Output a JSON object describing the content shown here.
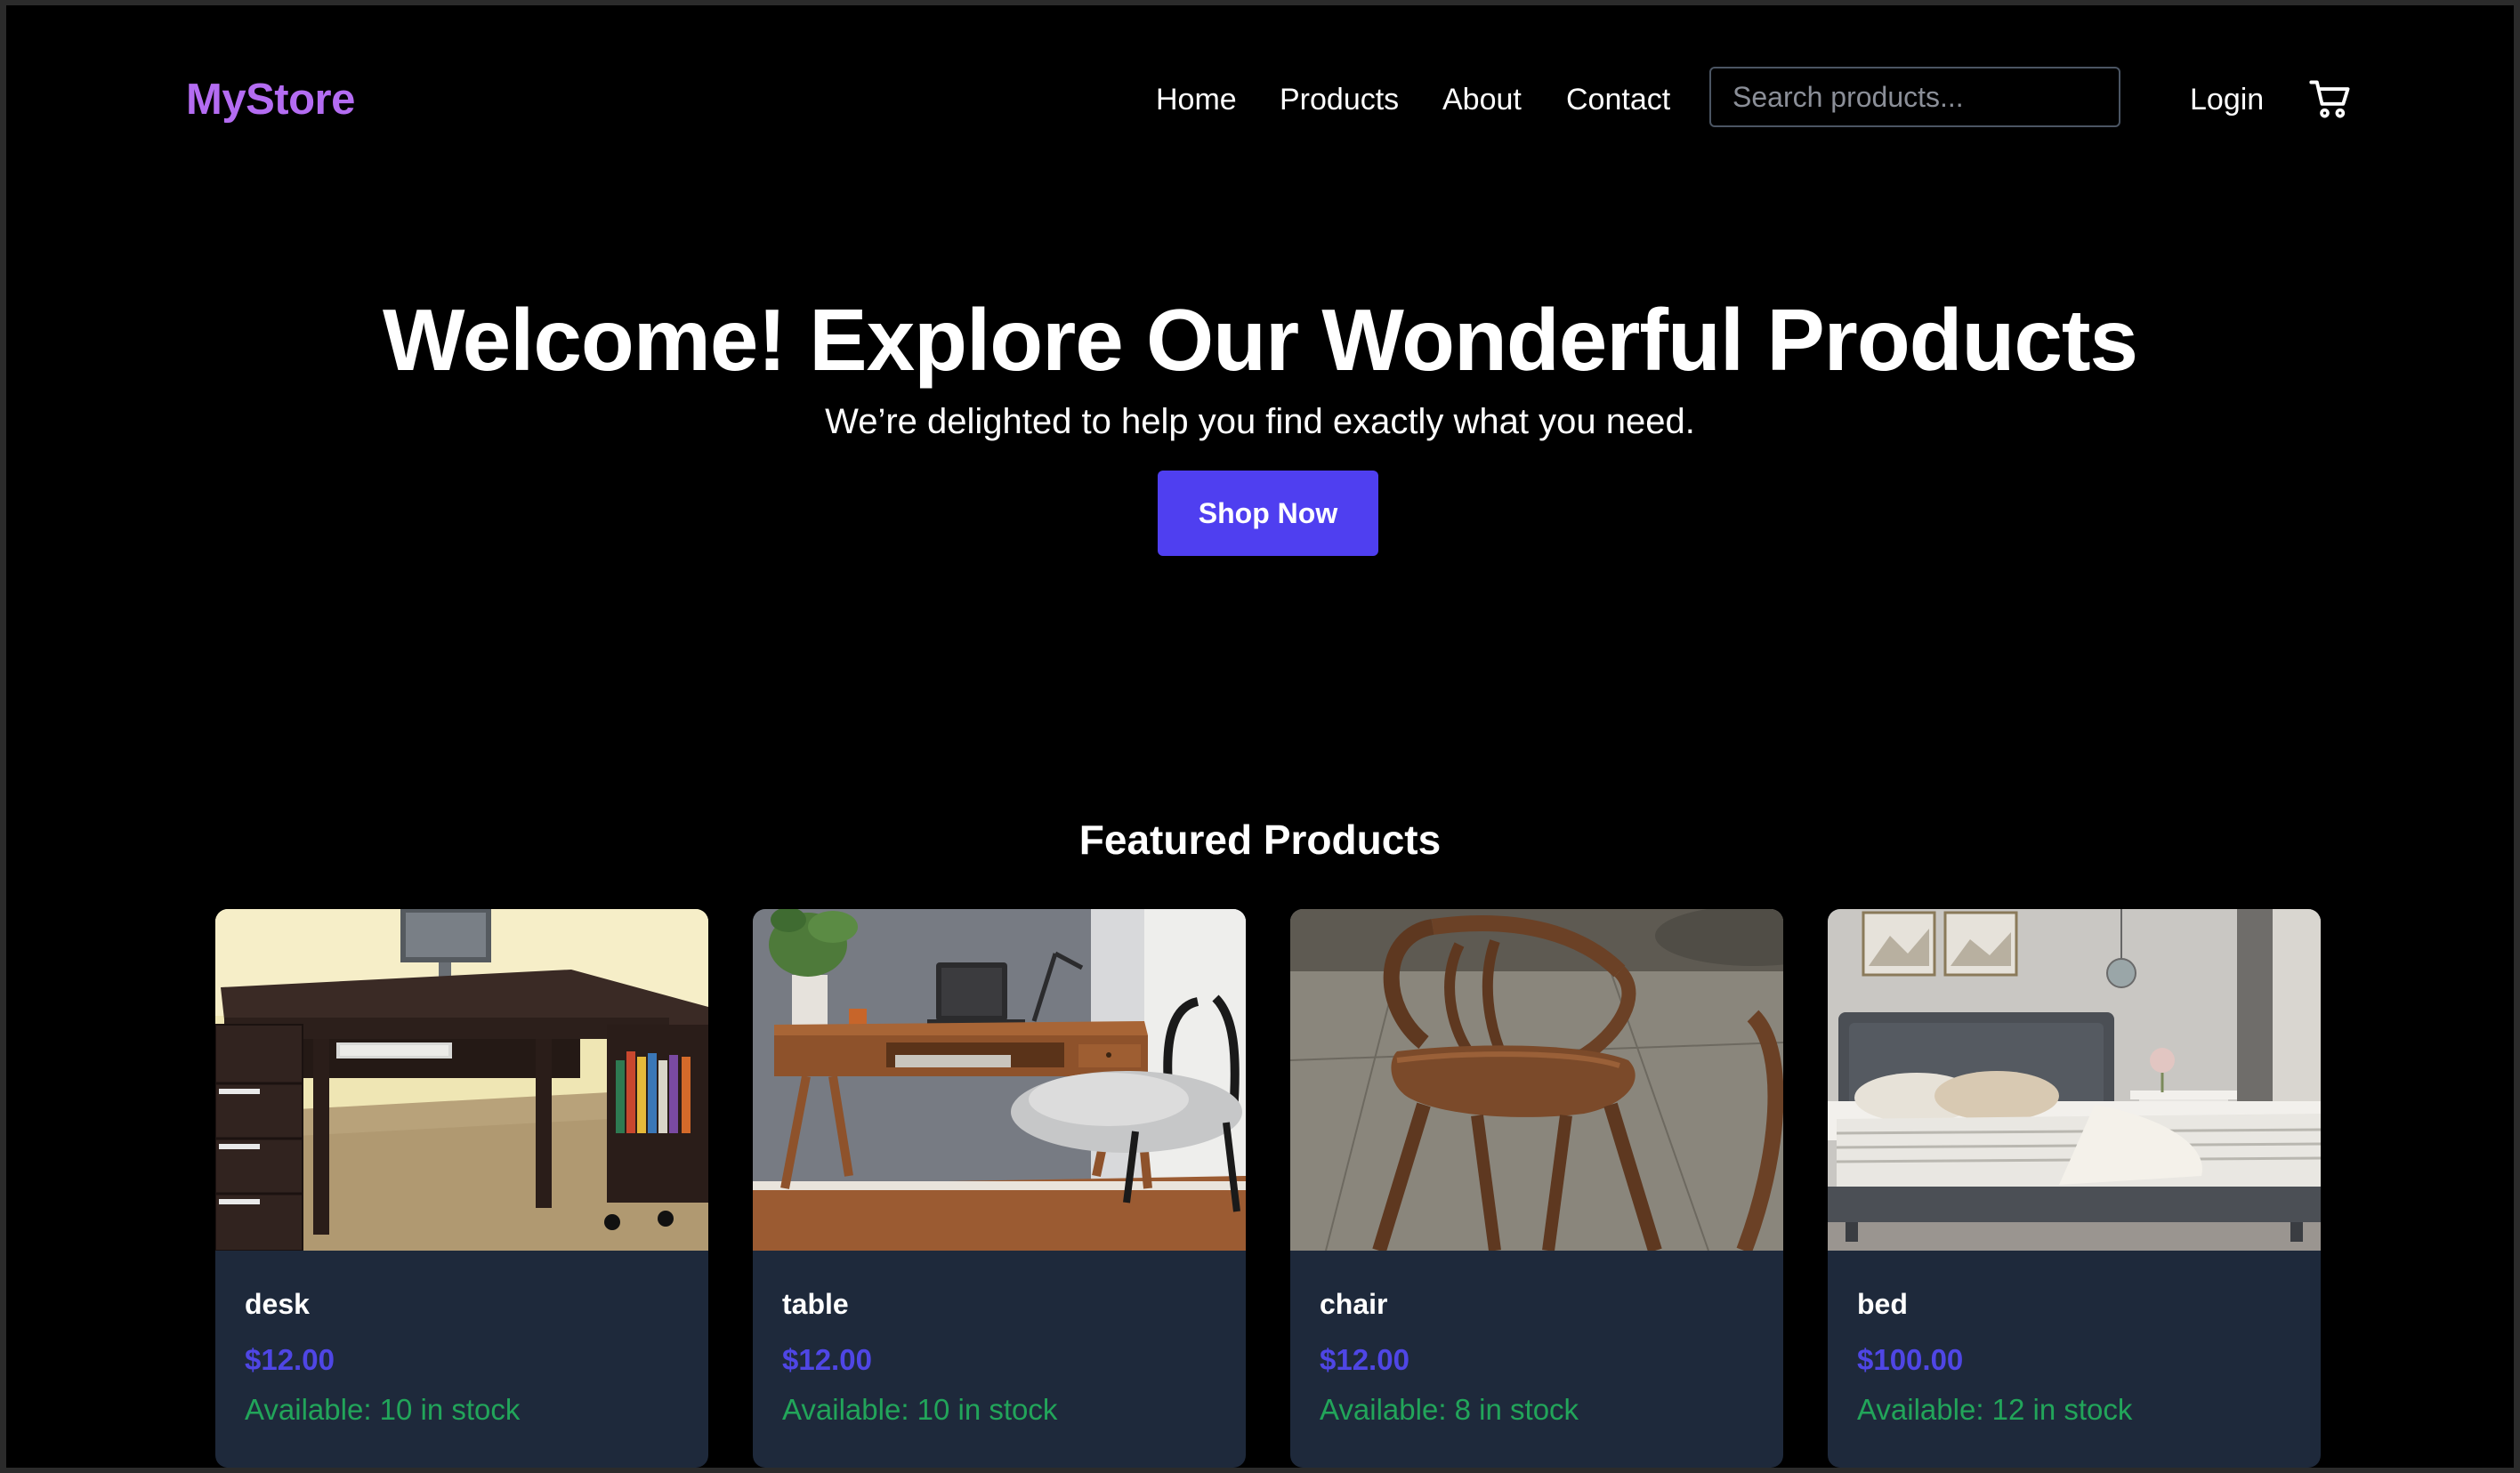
{
  "nav": {
    "logo": "MyStore",
    "links": [
      "Home",
      "Products",
      "About",
      "Contact"
    ],
    "search_placeholder": "Search products...",
    "login_label": "Login",
    "cart_icon": "shopping-cart-icon"
  },
  "hero": {
    "title": "Welcome! Explore Our Wonderful Products",
    "subtitle": "We’re delighted to help you find exactly what you need.",
    "button_label": "Shop Now"
  },
  "featured": {
    "title": "Featured Products",
    "products": [
      {
        "name": "desk",
        "price": "$12.00",
        "stock": "Available: 10 in stock"
      },
      {
        "name": "table",
        "price": "$12.00",
        "stock": "Available: 10 in stock"
      },
      {
        "name": "chair",
        "price": "$12.00",
        "stock": "Available: 8 in stock"
      },
      {
        "name": "bed",
        "price": "$100.00",
        "stock": "Available: 12 in stock"
      }
    ]
  },
  "colors": {
    "background": "#000000",
    "brand": "#b46cf2",
    "accent_button": "#4f3ff0",
    "card_bg": "#1e293b",
    "price": "#4f46e5",
    "stock": "#22a55a"
  }
}
